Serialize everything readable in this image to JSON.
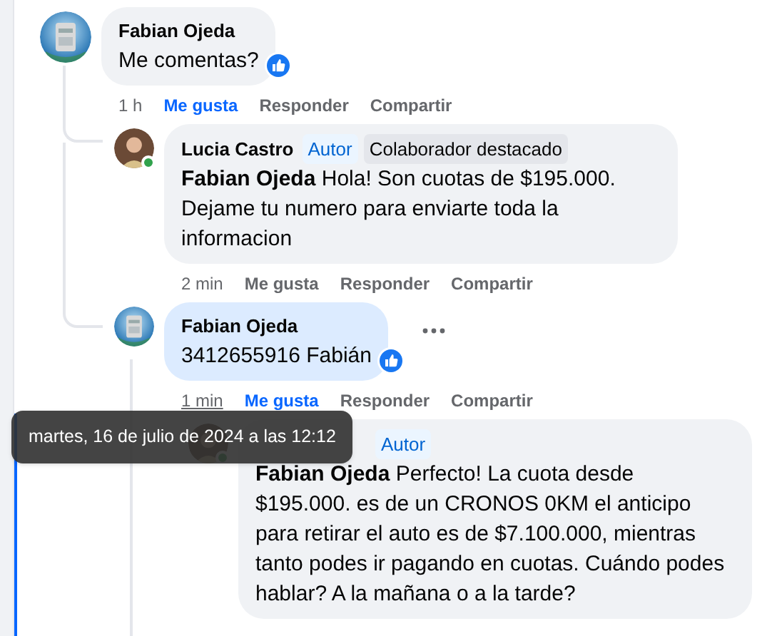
{
  "comment": {
    "author": "Fabian Ojeda",
    "kind": "visitor",
    "text": "Me comentas?",
    "reaction": true,
    "time": "1 h",
    "time_hovered": false,
    "liked": true,
    "highlighted": false,
    "actions": [
      "Me gusta",
      "Responder",
      "Compartir"
    ],
    "replies": [
      {
        "author": "Lucia Castro",
        "kind": "page_author",
        "online": true,
        "badges": [
          {
            "kind": "author",
            "label": "Autor"
          },
          {
            "kind": "contributor",
            "label": "Colaborador destacado"
          }
        ],
        "text": "**Fabian Ojeda** Hola! Son cuotas de $195.000. Dejame tu numero para enviarte toda la informacion",
        "reaction": false,
        "time": "2 min",
        "time_hovered": false,
        "liked": false,
        "highlighted": false,
        "actions": [
          "Me gusta",
          "Responder",
          "Compartir"
        ]
      },
      {
        "author": "Fabian Ojeda",
        "kind": "visitor",
        "text": "3412655916 Fabián",
        "reaction": true,
        "more_menu": true,
        "time": "1 min",
        "time_hovered": true,
        "liked": true,
        "highlighted": true,
        "actions": [
          "Me gusta",
          "Responder",
          "Compartir"
        ],
        "replies": [
          {
            "kind": "page_author",
            "online": true,
            "badges": [
              {
                "kind": "author",
                "label": "Autor"
              }
            ],
            "text": "**Fabian Ojeda** Perfecto! La cuota desde $195.000. es de un CRONOS 0KM el anticipo para retirar el auto es de $7.100.000, mientras tanto podes ir pagando en cuotas. Cuándo podes hablar? A la mañana o a la tarde?",
            "reaction": false,
            "highlighted": false
          }
        ]
      }
    ]
  },
  "tooltip": {
    "text": "martes, 16 de julio de 2024 a las 12:12"
  }
}
